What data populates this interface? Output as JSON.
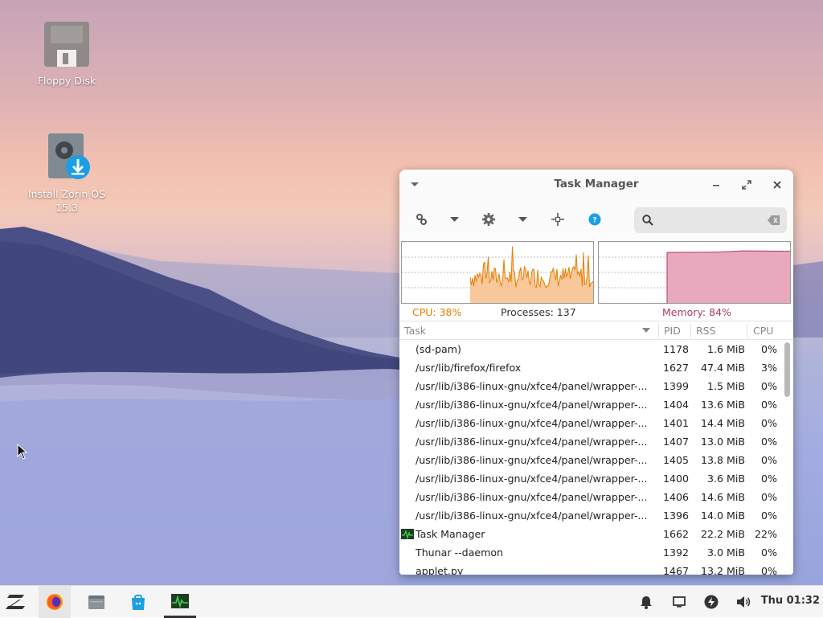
{
  "desktop": {
    "icons": [
      {
        "label": "Floppy Disk"
      },
      {
        "label": "Install Zorin OS 15.3"
      }
    ]
  },
  "window": {
    "title": "Task Manager",
    "search": {
      "value": "",
      "placeholder": ""
    },
    "stats": {
      "cpu": "CPU: 38%",
      "processes": "Processes: 137",
      "memory": "Memory: 84%"
    },
    "meters": {
      "cpu_percent": 38,
      "memory_percent": 84
    },
    "columns": {
      "task": "Task",
      "pid": "PID",
      "rss": "RSS",
      "cpu": "CPU"
    },
    "rows": [
      {
        "task": "(sd-pam)",
        "pid": "1178",
        "rss": "1.6 MiB",
        "cpu": "0%"
      },
      {
        "task": "/usr/lib/firefox/firefox",
        "pid": "1627",
        "rss": "47.4 MiB",
        "cpu": "3%"
      },
      {
        "task": "/usr/lib/i386-linux-gnu/xfce4/panel/wrapper-...",
        "pid": "1399",
        "rss": "1.5 MiB",
        "cpu": "0%"
      },
      {
        "task": "/usr/lib/i386-linux-gnu/xfce4/panel/wrapper-...",
        "pid": "1404",
        "rss": "13.6 MiB",
        "cpu": "0%"
      },
      {
        "task": "/usr/lib/i386-linux-gnu/xfce4/panel/wrapper-...",
        "pid": "1401",
        "rss": "14.4 MiB",
        "cpu": "0%"
      },
      {
        "task": "/usr/lib/i386-linux-gnu/xfce4/panel/wrapper-...",
        "pid": "1407",
        "rss": "13.0 MiB",
        "cpu": "0%"
      },
      {
        "task": "/usr/lib/i386-linux-gnu/xfce4/panel/wrapper-...",
        "pid": "1405",
        "rss": "13.8 MiB",
        "cpu": "0%"
      },
      {
        "task": "/usr/lib/i386-linux-gnu/xfce4/panel/wrapper-...",
        "pid": "1400",
        "rss": "3.6 MiB",
        "cpu": "0%"
      },
      {
        "task": "/usr/lib/i386-linux-gnu/xfce4/panel/wrapper-...",
        "pid": "1406",
        "rss": "14.6 MiB",
        "cpu": "0%"
      },
      {
        "task": "/usr/lib/i386-linux-gnu/xfce4/panel/wrapper-...",
        "pid": "1396",
        "rss": "14.0 MiB",
        "cpu": "0%"
      },
      {
        "task": "Task Manager",
        "pid": "1662",
        "rss": "22.2 MiB",
        "cpu": "22%",
        "icon": "task-manager-icon"
      },
      {
        "task": "Thunar --daemon",
        "pid": "1392",
        "rss": "3.0 MiB",
        "cpu": "0%"
      },
      {
        "task": "applet.py",
        "pid": "1467",
        "rss": "13.2 MiB",
        "cpu": "0%"
      }
    ]
  },
  "taskbar": {
    "clock": "Thu 01:32",
    "apps": [
      "zorin-menu-icon",
      "firefox-icon",
      "files-icon",
      "software-store-icon",
      "task-manager-icon"
    ],
    "tray": [
      "notification-bell-icon",
      "display-icon",
      "power-icon",
      "volume-icon"
    ]
  },
  "colors": {
    "cpu": "#e67e00",
    "memory": "#b03a5b",
    "cpu_fill": "#f8c89a",
    "memory_fill": "#e8a8bd",
    "accent_blue": "#1a9fe6"
  }
}
